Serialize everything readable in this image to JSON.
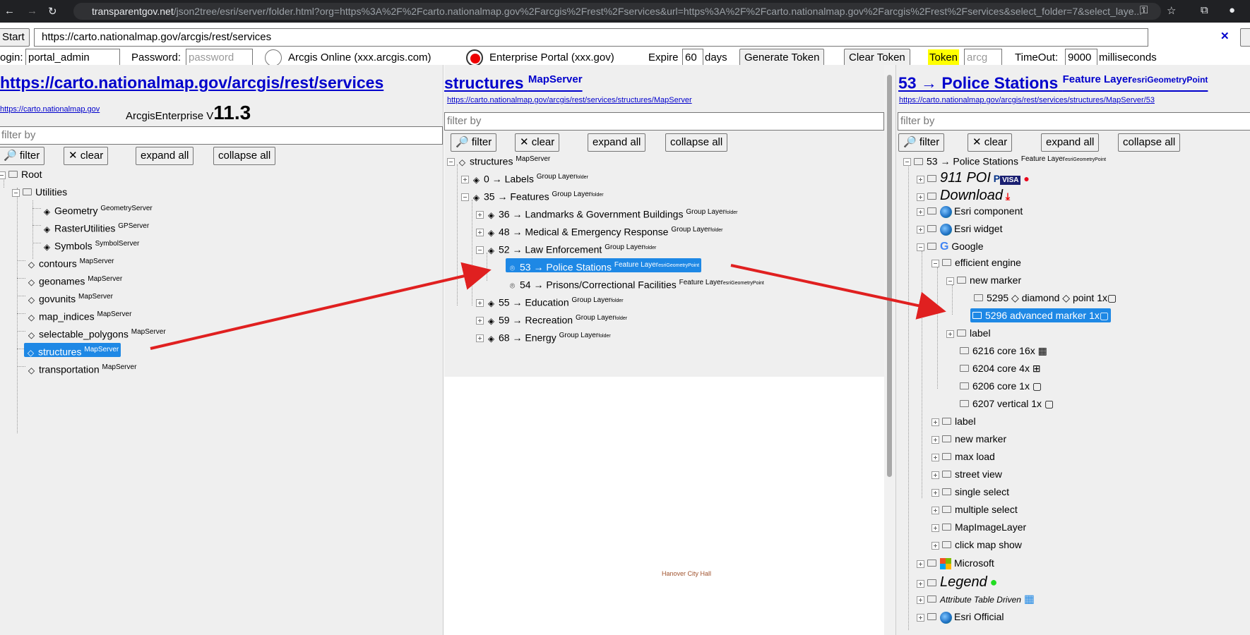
{
  "browser": {
    "url_host": "transparentgov.net",
    "url_rest": "/json2tree/esri/server/folder.html?org=https%3A%2F%2Fcarto.nationalmap.gov%2Farcgis%2Frest%2Fservices&url=https%3A%2F%2Fcarto.nationalmap.gov%2Farcgis%2Frest%2Fservices&select_folder=7&select_laye..."
  },
  "toolbar": {
    "start_label": "Start",
    "service_url": "https://carto.nationalmap.gov/arcgis/rest/services",
    "clear_x": "✕",
    "login_label": "ogin:",
    "login_value": "portal_admin",
    "password_label": "Password:",
    "password_placeholder": "password",
    "arcgis_online_label": "Arcgis Online (xxx.arcgis.com)",
    "enterprise_label": "Enterprise Portal (xxx.gov)",
    "expire_label": "Expire",
    "expire_value": "60",
    "days_label": "days",
    "generate_token": "Generate Token",
    "clear_token": "Clear Token",
    "token_label": "Token",
    "token_placeholder": "arcg",
    "timeout_label": "TimeOut:",
    "timeout_value": "9000",
    "ms_label": "milliseconds"
  },
  "left": {
    "title": "https://carto.nationalmap.gov/arcgis/rest/services",
    "sublink": "https://carto.nationalmap.gov",
    "version_prefix": "ArcgisEnterprise V",
    "version": "11.3",
    "filter_placeholder": "filter by",
    "btn_filter": "filter",
    "btn_clear": "clear",
    "btn_expand": "expand all",
    "btn_collapse": "collapse all",
    "root": "Root",
    "utilities": "Utilities",
    "items": [
      {
        "name": "Geometry",
        "type": "GeometryServer"
      },
      {
        "name": "RasterUtilities",
        "type": "GPServer"
      },
      {
        "name": "Symbols",
        "type": "SymbolServer"
      },
      {
        "name": "contours",
        "type": "MapServer"
      },
      {
        "name": "geonames",
        "type": "MapServer"
      },
      {
        "name": "govunits",
        "type": "MapServer"
      },
      {
        "name": "map_indices",
        "type": "MapServer"
      },
      {
        "name": "selectable_polygons",
        "type": "MapServer"
      },
      {
        "name": "structures",
        "type": "MapServer"
      },
      {
        "name": "transportation",
        "type": "MapServer"
      }
    ]
  },
  "middle": {
    "title": "structures",
    "title_type": "MapServer",
    "sublink": "https://carto.nationalmap.gov/arcgis/rest/services/structures/MapServer",
    "filter_placeholder": "filter by",
    "btn_filter": "filter",
    "btn_clear": "clear",
    "btn_expand": "expand all",
    "btn_collapse": "collapse all",
    "root": "structures",
    "root_type": "MapServer",
    "nodes": [
      {
        "name": "0 → Labels",
        "type": "Group Layer",
        "sub": "folder"
      },
      {
        "name": "35 → Features",
        "type": "Group Layer",
        "sub": "folder"
      },
      {
        "name": "36 → Landmarks & Government Buildings",
        "type": "Group Layer",
        "sub": "folder"
      },
      {
        "name": "48 → Medical & Emergency Response",
        "type": "Group Layer",
        "sub": "folder"
      },
      {
        "name": "52 → Law Enforcement",
        "type": "Group Layer",
        "sub": "folder"
      },
      {
        "name": "53 → Police Stations",
        "type": "Feature Layer",
        "sub": "esriGeometryPoint"
      },
      {
        "name": "54 → Prisons/Correctional Facilities",
        "type": "Feature Layer",
        "sub": "esriGeometryPoint"
      },
      {
        "name": "55 → Education",
        "type": "Group Layer",
        "sub": "folder"
      },
      {
        "name": "59 → Recreation",
        "type": "Group Layer",
        "sub": "folder"
      },
      {
        "name": "68 → Energy",
        "type": "Group Layer",
        "sub": "folder"
      }
    ],
    "map_label": "Hanover City Hall"
  },
  "right": {
    "title": "53 → Police Stations",
    "title_type": "Feature Layer",
    "title_sub": "esriGeometryPoint",
    "sublink": "https://carto.nationalmap.gov/arcgis/rest/services/structures/MapServer/53",
    "filter_placeholder": "filter by",
    "btn_filter": "filter",
    "btn_clear": "clear",
    "btn_expand": "expand all",
    "btn_collapse": "collapse all",
    "root": "53 → Police Stations",
    "root_type": "Feature Layer",
    "root_sub": "esriGeometryPoint",
    "n911": "911 POI",
    "download": "Download",
    "esri_component": "Esri component",
    "esri_widget": "Esri widget",
    "google": "Google",
    "efficient_engine": "efficient engine",
    "new_marker": "new marker",
    "m5295": "5295 ◇ diamond ◇ point 1x▢",
    "m5296": "5296 advanced marker 1x▢",
    "label": "label",
    "c6216": "6216 core 16x ▦",
    "c6204": "6204 core 4x ⊞",
    "c6206": "6206 core 1x ▢",
    "c6207": "6207 vertical 1x ▢",
    "g_label": "label",
    "g_new_marker": "new marker",
    "max_load": "max load",
    "street_view": "street view",
    "single_select": "single select",
    "multiple_select": "multiple select",
    "mapimagelayer": "MapImageLayer",
    "click_map_show": "click map show",
    "microsoft": "Microsoft",
    "legend": "Legend",
    "attribute_table": "Attribute Table Driven",
    "esri_official": "Esri Official"
  },
  "colors": {
    "link": "#0000cc",
    "selected": "#1e88e5",
    "arrow": "#e02020",
    "token_bg": "#ffff00"
  }
}
